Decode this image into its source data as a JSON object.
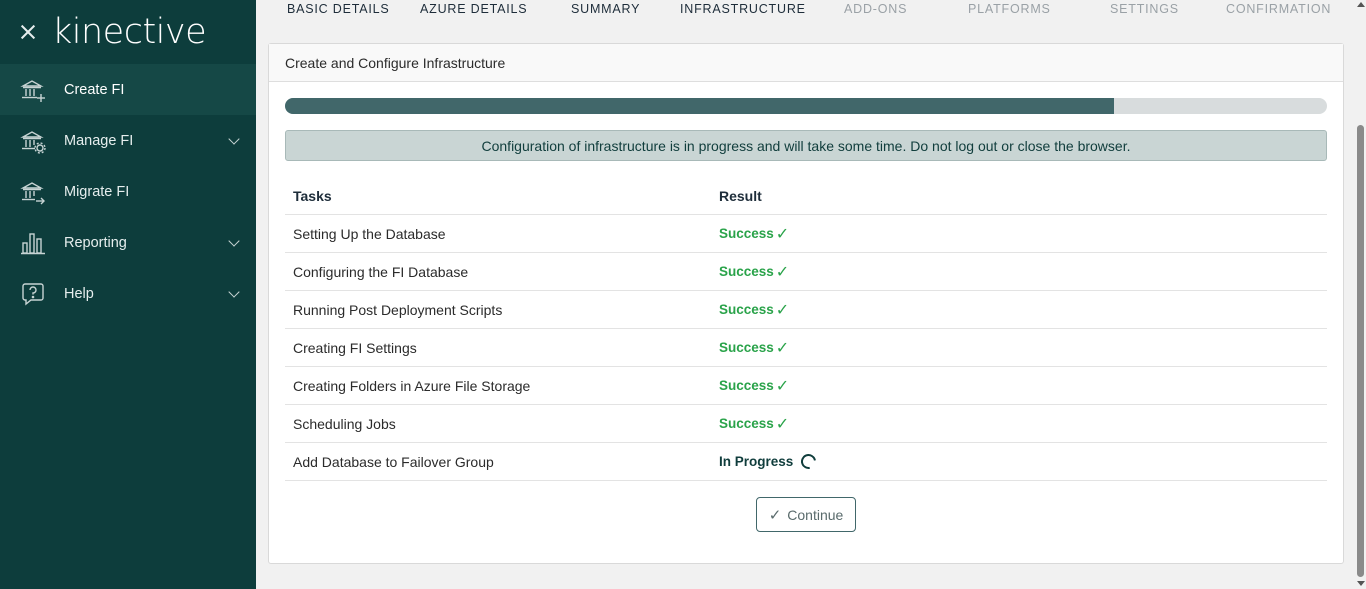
{
  "sidebar": {
    "logo": "kinective",
    "items": [
      {
        "label": "Create FI",
        "icon": "bank-plus-icon",
        "active": true,
        "has_chevron": false
      },
      {
        "label": "Manage FI",
        "icon": "bank-gear-icon",
        "active": false,
        "has_chevron": true
      },
      {
        "label": "Migrate FI",
        "icon": "bank-arrow-icon",
        "active": false,
        "has_chevron": false
      },
      {
        "label": "Reporting",
        "icon": "bar-chart-icon",
        "active": false,
        "has_chevron": true
      },
      {
        "label": "Help",
        "icon": "help-bubble-icon",
        "active": false,
        "has_chevron": true
      }
    ]
  },
  "steps": [
    {
      "label": "BASIC DETAILS",
      "enabled": true
    },
    {
      "label": "AZURE DETAILS",
      "enabled": true
    },
    {
      "label": "SUMMARY",
      "enabled": true
    },
    {
      "label": "INFRASTRUCTURE",
      "enabled": true
    },
    {
      "label": "ADD-ONS",
      "enabled": false
    },
    {
      "label": "PLATFORMS",
      "enabled": false
    },
    {
      "label": "SETTINGS",
      "enabled": false
    },
    {
      "label": "CONFIRMATION",
      "enabled": false
    }
  ],
  "card": {
    "title": "Create and Configure Infrastructure",
    "progress_fraction": 0.796,
    "alert": "Configuration of infrastructure is in progress and will take some time. Do not log out or close the browser.",
    "table": {
      "headers": {
        "task": "Tasks",
        "result": "Result"
      },
      "rows": [
        {
          "task": "Setting Up the Database",
          "result": "Success",
          "status": "success"
        },
        {
          "task": "Configuring the FI Database",
          "result": "Success",
          "status": "success"
        },
        {
          "task": "Running Post Deployment Scripts",
          "result": "Success",
          "status": "success"
        },
        {
          "task": "Creating FI Settings",
          "result": "Success",
          "status": "success"
        },
        {
          "task": "Creating Folders in Azure File Storage",
          "result": "Success",
          "status": "success"
        },
        {
          "task": "Scheduling Jobs",
          "result": "Success",
          "status": "success"
        },
        {
          "task": "Add Database to Failover Group",
          "result": "In Progress",
          "status": "in-progress"
        }
      ]
    },
    "continue_label": "Continue"
  },
  "colors": {
    "sidebar_bg": "#0d3d3c",
    "accent": "#41676a",
    "success": "#2aa34a"
  }
}
